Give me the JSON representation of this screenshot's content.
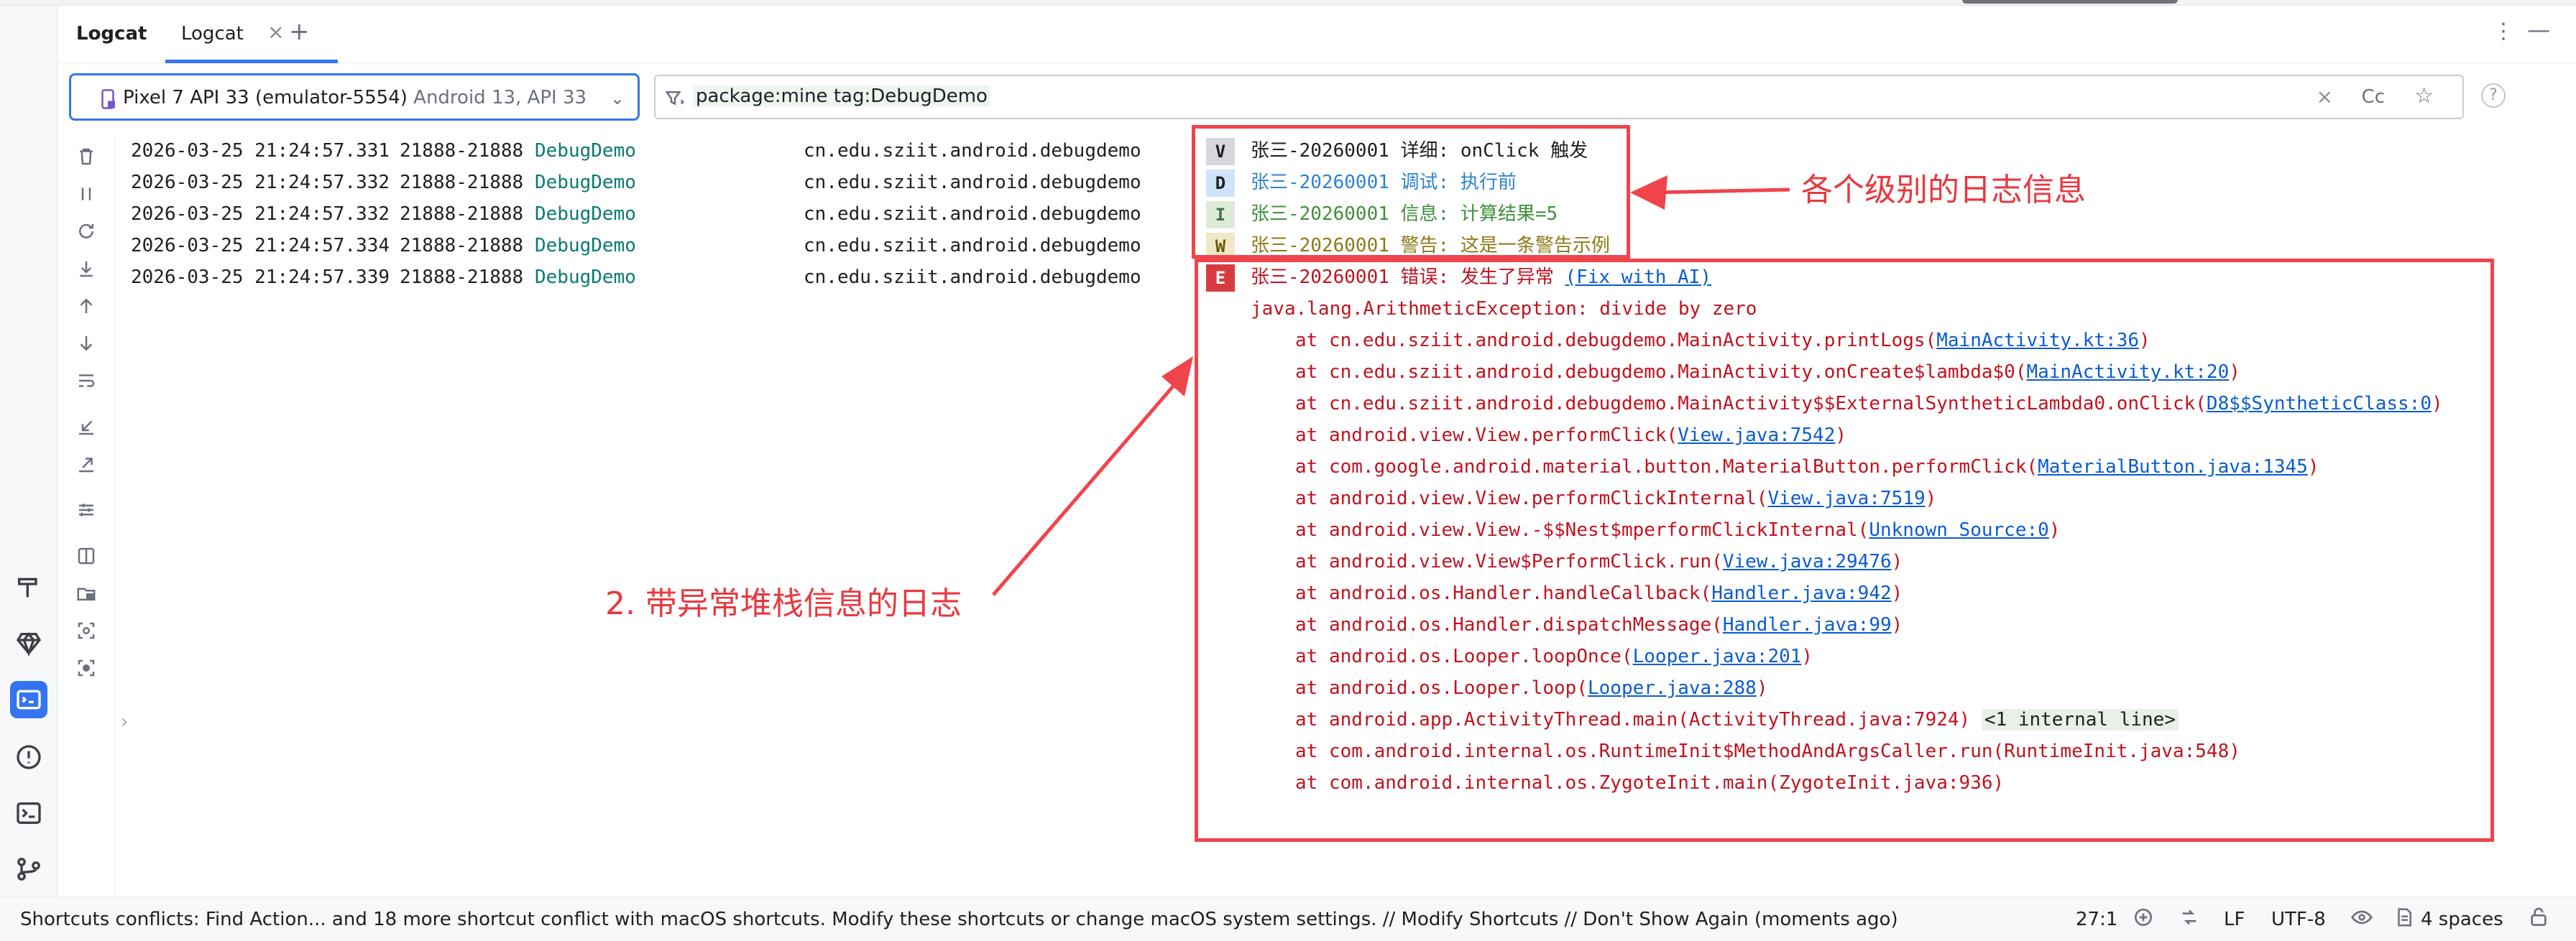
{
  "toolwindow": {
    "title": "Logcat",
    "tab_label": "Logcat",
    "tab_close": "×",
    "add_tab": "+",
    "more": "⋮",
    "minimize": "—"
  },
  "device": {
    "name": "Pixel 7 API 33 (emulator-5554)",
    "api": "Android 13, API 33",
    "chevron": "⌄"
  },
  "filter": {
    "query": "package:mine tag:DebugDemo",
    "clear": "×",
    "case_toggle": "Cc",
    "favorite": "☆",
    "help": "?"
  },
  "log_rows": [
    {
      "ts": "2026-03-25 21:24:57.331",
      "pid": "21888-21888",
      "tag": "DebugDemo",
      "pkg": "cn.edu.sziit.android.debugdemo",
      "level": "V",
      "message": "张三-20260001 详细: onClick 触发"
    },
    {
      "ts": "2026-03-25 21:24:57.332",
      "pid": "21888-21888",
      "tag": "DebugDemo",
      "pkg": "cn.edu.sziit.android.debugdemo",
      "level": "D",
      "message": "张三-20260001 调试: 执行前"
    },
    {
      "ts": "2026-03-25 21:24:57.332",
      "pid": "21888-21888",
      "tag": "DebugDemo",
      "pkg": "cn.edu.sziit.android.debugdemo",
      "level": "I",
      "message": "张三-20260001 信息: 计算结果=5"
    },
    {
      "ts": "2026-03-25 21:24:57.334",
      "pid": "21888-21888",
      "tag": "DebugDemo",
      "pkg": "cn.edu.sziit.android.debugdemo",
      "level": "W",
      "message": "张三-20260001 警告: 这是一条警告示例"
    },
    {
      "ts": "2026-03-25 21:24:57.339",
      "pid": "21888-21888",
      "tag": "DebugDemo",
      "pkg": "cn.edu.sziit.android.debugdemo",
      "level": "E",
      "message": "张三-20260001 错误: 发生了异常 ",
      "fix_link": "(Fix with AI)"
    }
  ],
  "level_colors": {
    "V": {
      "bg": "#d5d7dc",
      "fg": "#1e1f22",
      "msg": "#1e1f22"
    },
    "D": {
      "bg": "#cfe4fb",
      "fg": "#1e1f22",
      "msg": "#2e83cf"
    },
    "I": {
      "bg": "#dcebd8",
      "fg": "#44734a",
      "msg": "#3f8f3a"
    },
    "W": {
      "bg": "#efe8c6",
      "fg": "#6b5b12",
      "msg": "#8a7a16"
    },
    "E": {
      "bg": "#d83b3f",
      "fg": "#ffffff",
      "msg": "#c1121f"
    }
  },
  "exception_header": "java.lang.ArithmeticException: divide by zero",
  "stack": [
    {
      "pre": "at cn.edu.sziit.android.debugdemo.MainActivity.printLogs(",
      "link": "MainActivity.kt:36",
      "post": ")"
    },
    {
      "pre": "at cn.edu.sziit.android.debugdemo.MainActivity.onCreate$lambda$0(",
      "link": "MainActivity.kt:20",
      "post": ")"
    },
    {
      "pre": "at cn.edu.sziit.android.debugdemo.MainActivity$$ExternalSyntheticLambda0.onClick(",
      "link": "D8$$SyntheticClass:0",
      "post": ")"
    },
    {
      "pre": "at android.view.View.performClick(",
      "link": "View.java:7542",
      "post": ")"
    },
    {
      "pre": "at com.google.android.material.button.MaterialButton.performClick(",
      "link": "MaterialButton.java:1345",
      "post": ")"
    },
    {
      "pre": "at android.view.View.performClickInternal(",
      "link": "View.java:7519",
      "post": ")"
    },
    {
      "pre": "at android.view.View.-$$Nest$mperformClickInternal(",
      "link": "Unknown Source:0",
      "post": ")"
    },
    {
      "pre": "at android.view.View$PerformClick.run(",
      "link": "View.java:29476",
      "post": ")"
    },
    {
      "pre": "at android.os.Handler.handleCallback(",
      "link": "Handler.java:942",
      "post": ")"
    },
    {
      "pre": "at android.os.Handler.dispatchMessage(",
      "link": "Handler.java:99",
      "post": ")"
    },
    {
      "pre": "at android.os.Looper.loopOnce(",
      "link": "Looper.java:201",
      "post": ")"
    },
    {
      "pre": "at android.os.Looper.loop(",
      "link": "Looper.java:288",
      "post": ")"
    },
    {
      "pre": "at android.app.ActivityThread.main(ActivityThread.java:7924)",
      "link": "",
      "post": "",
      "badge": "<1 internal line>"
    },
    {
      "pre": "at com.android.internal.os.RuntimeInit$MethodAndArgsCaller.run(RuntimeInit.java:548)",
      "link": "",
      "post": ""
    },
    {
      "pre": "at com.android.internal.os.ZygoteInit.main(ZygoteInit.java:936)",
      "link": "",
      "post": ""
    }
  ],
  "annotations": {
    "levels_label": "各个级别的日志信息",
    "stack_label": "2. 带异常堆栈信息的日志"
  },
  "accent_color": "#3574f0",
  "annotation_color": "#f0444c",
  "statusbar": {
    "message": "Shortcuts conflicts: Find Action... and 18 more shortcut conflict with macOS shortcuts. Modify these shortcuts or change macOS system settings. // Modify Shortcuts // Don't Show Again (moments ago)",
    "position": "27:1",
    "line_sep": "LF",
    "encoding": "UTF-8",
    "indent": "4 spaces"
  },
  "collapse_arrow": "›"
}
